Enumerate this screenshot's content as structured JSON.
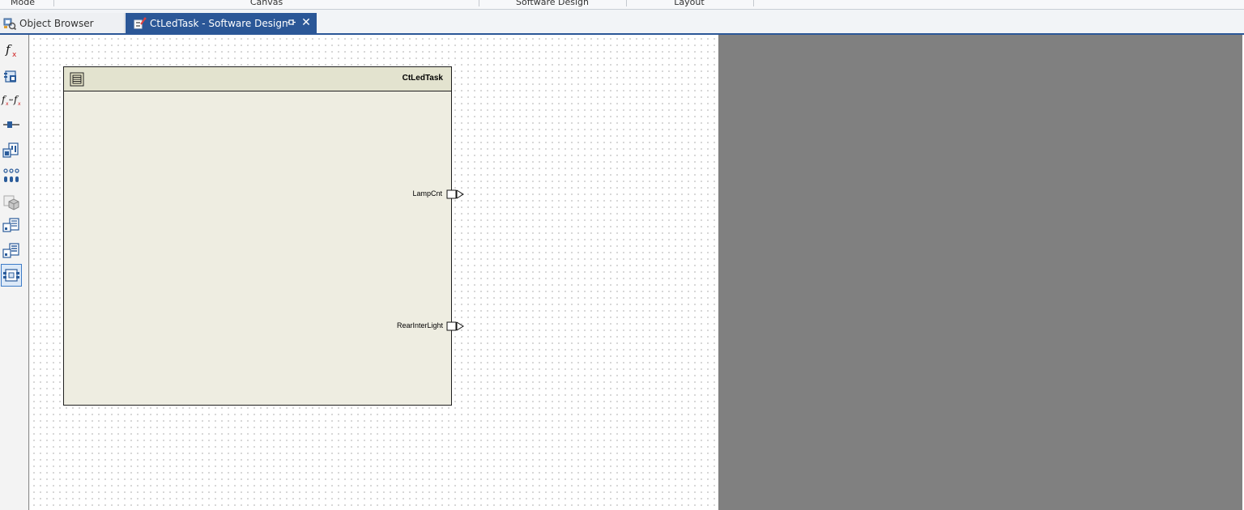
{
  "ribbon": {
    "groups": [
      {
        "label": "Mode"
      },
      {
        "label": "Canvas"
      },
      {
        "label": "Software Design"
      },
      {
        "label": "Layout"
      }
    ]
  },
  "tabs": {
    "object_browser": {
      "label": "Object Browser",
      "icon": "object-browser-icon"
    },
    "active": {
      "label": "CtLedTask - Software Design",
      "icon": "software-design-icon",
      "pin_icon": "pin-icon",
      "close": "✕"
    }
  },
  "toolbar": {
    "tools": [
      {
        "name": "function-tool",
        "icon": "fx-icon"
      },
      {
        "name": "component-tool",
        "icon": "component-icon"
      },
      {
        "name": "function-link-tool",
        "icon": "fx-link-fx-icon"
      },
      {
        "name": "connector-tool",
        "icon": "connector-icon"
      },
      {
        "name": "module-tool",
        "icon": "module-icon"
      },
      {
        "name": "port-group-tool",
        "icon": "port-group-icon"
      },
      {
        "name": "package-tool",
        "icon": "package-icon"
      },
      {
        "name": "interface-tool",
        "icon": "interface-icon"
      },
      {
        "name": "interface-list-tool",
        "icon": "interface-list-icon"
      },
      {
        "name": "composition-tool",
        "icon": "composition-icon",
        "selected": true
      }
    ]
  },
  "component": {
    "title": "CtLedTask",
    "icon": "component-type-icon",
    "ports": [
      {
        "label": "LampCnt"
      },
      {
        "label": "RearInterLight"
      }
    ]
  },
  "colors": {
    "tab_active_bg": "#2b5797",
    "component_body": "#eeede1",
    "component_header": "#e3e3cf",
    "gray_area": "#808080"
  }
}
